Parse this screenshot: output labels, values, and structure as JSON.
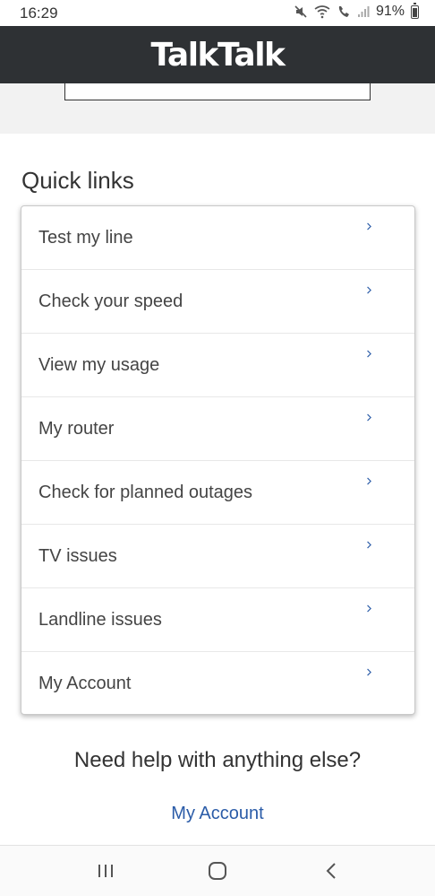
{
  "status_bar": {
    "time": "16:29",
    "battery_percent": "91%",
    "icons": [
      "mute-icon",
      "wifi-icon",
      "wifi-calling-icon",
      "signal-icon",
      "battery-icon"
    ]
  },
  "header": {
    "logo_text": "TalkTalk",
    "background": "#2e3134"
  },
  "quick_links": {
    "title": "Quick links",
    "items": [
      {
        "label": "Test my line"
      },
      {
        "label": "Check your speed"
      },
      {
        "label": "View my usage"
      },
      {
        "label": "My router"
      },
      {
        "label": "Check for planned outages"
      },
      {
        "label": "TV issues"
      },
      {
        "label": "Landline issues"
      },
      {
        "label": "My Account"
      }
    ],
    "chevron_icon": "chevron-right-icon",
    "accent_color": "#2b5ca8"
  },
  "help": {
    "heading": "Need help with anything else?",
    "link_label": "My Account"
  },
  "nav_bar": {
    "buttons": [
      "recent-apps-icon",
      "home-icon",
      "back-icon"
    ]
  }
}
